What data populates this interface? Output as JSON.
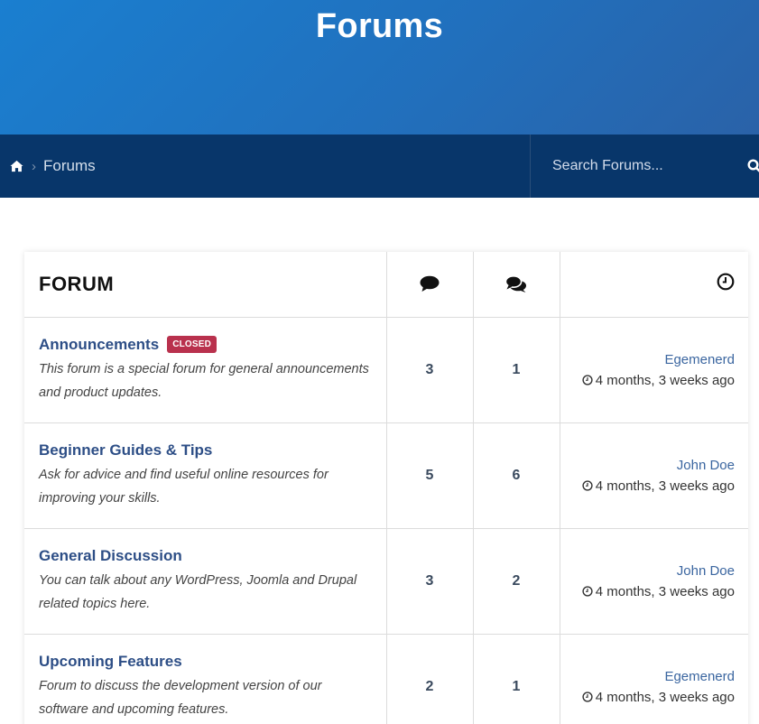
{
  "header": {
    "title": "Forums"
  },
  "breadcrumb": {
    "home_icon": "home-icon",
    "separator": "›",
    "current": "Forums"
  },
  "search": {
    "placeholder": "Search Forums...",
    "icon": "search-icon"
  },
  "table": {
    "headers": {
      "forum": "FORUM",
      "topics_icon": "comment-icon",
      "posts_icon": "comments-icon",
      "last_post_icon": "clock-icon"
    },
    "rows": [
      {
        "title": "Announcements",
        "badge": "CLOSED",
        "description": "This forum is a special forum for general announcements and product updates.",
        "topics": "3",
        "posts": "1",
        "author": "Egemenerd",
        "time": "4 months, 3 weeks ago"
      },
      {
        "title": "Beginner Guides & Tips",
        "badge": "",
        "description": "Ask for advice and find useful online resources for improving your skills.",
        "topics": "5",
        "posts": "6",
        "author": "John Doe",
        "time": "4 months, 3 weeks ago"
      },
      {
        "title": "General Discussion",
        "badge": "",
        "description": "You can talk about any WordPress, Joomla and Drupal related topics here.",
        "topics": "3",
        "posts": "2",
        "author": "John Doe",
        "time": "4 months, 3 weeks ago"
      },
      {
        "title": "Upcoming Features",
        "badge": "",
        "description": "Forum to discuss the development version of our software and upcoming features.",
        "topics": "2",
        "posts": "1",
        "author": "Egemenerd",
        "time": "4 months, 3 weeks ago"
      }
    ]
  },
  "colors": {
    "hero": "#1f78c8",
    "breadcrumb_bar": "#08366a",
    "link": "#2d4e86",
    "badge": "#b9314d"
  }
}
